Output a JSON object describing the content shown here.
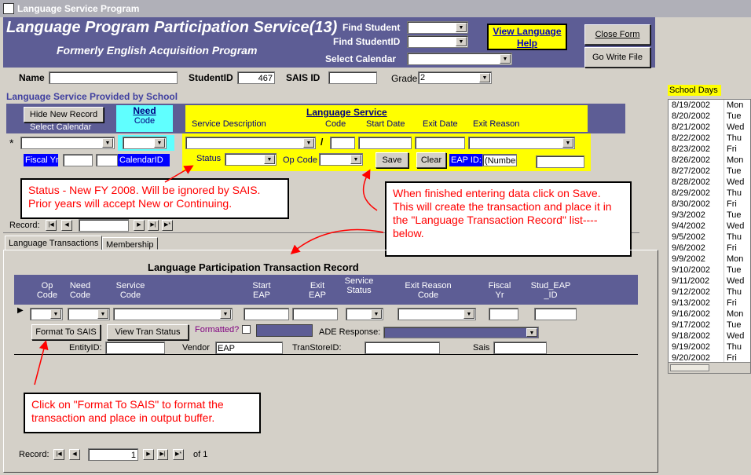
{
  "window": {
    "title": "Language Service Program"
  },
  "header": {
    "title": "Language Program Participation Service(13)",
    "subtitle": "Formerly English Acquisition Program",
    "find_student_label": "Find Student",
    "find_studentid_label": "Find StudentID",
    "select_calendar_label": "Select Calendar",
    "help_button": "View Language Help",
    "close_button": "Close Form",
    "go_write_button": "Go Write File"
  },
  "student": {
    "name_label": "Name",
    "studentid_label": "StudentID",
    "studentid_value": "467",
    "sais_label": "SAIS ID",
    "grade_label": "Grade",
    "grade_value": "2"
  },
  "service_section": {
    "title": "Language Service Provided by School",
    "hide_button": "Hide New Record",
    "select_calendar_caption": "Select Calendar",
    "need_header": "Need",
    "code_header": "Code",
    "language_service_header": "Language Service",
    "columns": {
      "service_description": "Service Description",
      "code": "Code",
      "start_date": "Start Date",
      "exit_date": "Exit Date",
      "exit_reason": "Exit Reason"
    },
    "fiscal_yr_label": "Fiscal Yr",
    "calendarid_label": "CalendarID",
    "status_label": "Status",
    "op_code_label": "Op Code",
    "save_button": "Save",
    "clear_button": "Clear",
    "eap_id_label": "EAP ID:",
    "eap_id_value": "(Number)",
    "slash": "/",
    "new_record_marker": "*",
    "record_label": "Record:"
  },
  "callouts": {
    "status": "Status - New FY 2008.  Will be ignored by SAIS. Prior years will accept New or Continuing.",
    "save": "When finished entering data click on Save. This will create the transaction and place it in the \"Language Transaction Record\" list----below.",
    "format": "Click on \"Format To SAIS\" to format the transaction and place in output buffer."
  },
  "tabs": [
    {
      "label": "Language Transactions"
    },
    {
      "label": "Membership"
    }
  ],
  "transactions": {
    "title": "Language Participation Transaction Record",
    "columns": [
      "Op Code",
      "Need Code",
      "Service Code",
      "Start EAP",
      "Exit EAP",
      "Service Status",
      "Exit Reason Code",
      "Fiscal Yr",
      "Stud_EAP _ID"
    ],
    "format_button": "Format To SAIS",
    "view_status_button": "View Tran Status",
    "formatted_label": "Formatted?",
    "ade_response_label": "ADE Response:",
    "entityid_label": "EntityID:",
    "vendor_label": "Vendor",
    "vendor_value": "EAP",
    "transtoreid_label": "TranStoreID:",
    "sais_label": "Sais",
    "record_label": "Record:",
    "record_value": "1",
    "record_of": "of  1"
  },
  "school_days": {
    "title": "School Days",
    "rows": [
      {
        "date": "8/19/2002",
        "day": "Mon"
      },
      {
        "date": "8/20/2002",
        "day": "Tue"
      },
      {
        "date": "8/21/2002",
        "day": "Wed"
      },
      {
        "date": "8/22/2002",
        "day": "Thu"
      },
      {
        "date": "8/23/2002",
        "day": "Fri"
      },
      {
        "date": "8/26/2002",
        "day": "Mon"
      },
      {
        "date": "8/27/2002",
        "day": "Tue"
      },
      {
        "date": "8/28/2002",
        "day": "Wed"
      },
      {
        "date": "8/29/2002",
        "day": "Thu"
      },
      {
        "date": "8/30/2002",
        "day": "Fri"
      },
      {
        "date": "9/3/2002",
        "day": "Tue"
      },
      {
        "date": "9/4/2002",
        "day": "Wed"
      },
      {
        "date": "9/5/2002",
        "day": "Thu"
      },
      {
        "date": "9/6/2002",
        "day": "Fri"
      },
      {
        "date": "9/9/2002",
        "day": "Mon"
      },
      {
        "date": "9/10/2002",
        "day": "Tue"
      },
      {
        "date": "9/11/2002",
        "day": "Wed"
      },
      {
        "date": "9/12/2002",
        "day": "Thu"
      },
      {
        "date": "9/13/2002",
        "day": "Fri"
      },
      {
        "date": "9/16/2002",
        "day": "Mon"
      },
      {
        "date": "9/17/2002",
        "day": "Tue"
      },
      {
        "date": "9/18/2002",
        "day": "Wed"
      },
      {
        "date": "9/19/2002",
        "day": "Thu"
      },
      {
        "date": "9/20/2002",
        "day": "Fri"
      }
    ]
  },
  "colors": {
    "header_bg": "#5d5d95",
    "highlight": "#ffff00",
    "callout_text": "#ff0000",
    "id_label_bg": "#0000ff"
  },
  "icons": [
    "app-system-icon",
    "dropdown-arrow-icon",
    "record-nav-first-icon",
    "record-nav-prev-icon",
    "record-nav-next-icon",
    "record-nav-last-icon",
    "record-nav-new-icon",
    "record-selector-icon",
    "new-record-marker-icon"
  ]
}
